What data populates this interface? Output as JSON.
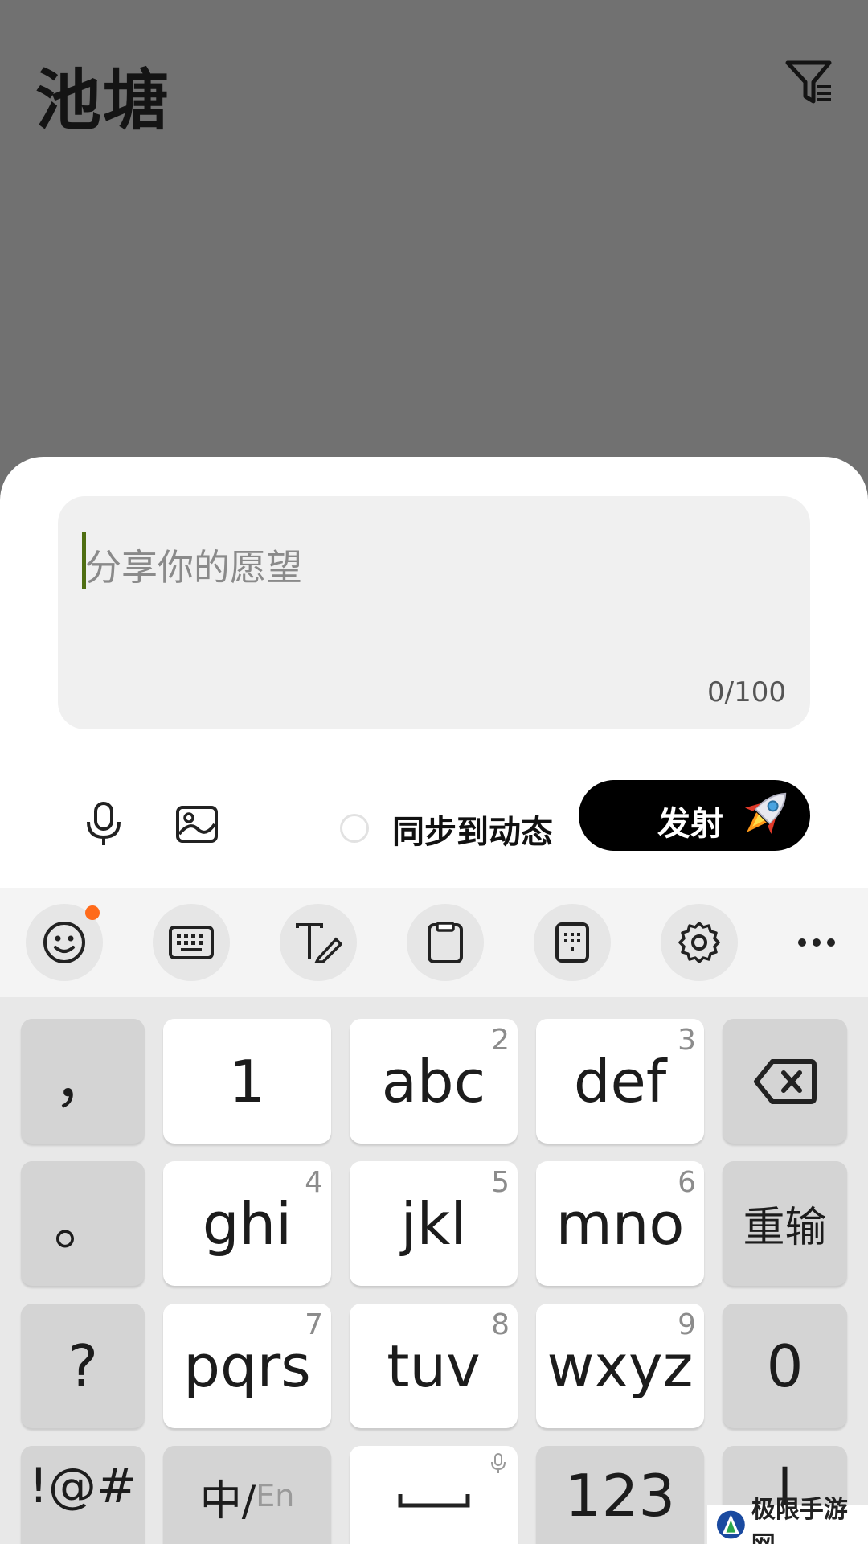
{
  "page": {
    "title": "池塘"
  },
  "icons": {
    "filter": "filter-icon",
    "mic": "microphone-icon",
    "image": "image-icon",
    "rocket": "rocket-icon",
    "emoji": "emoji-icon",
    "keyboard": "keyboard-icon",
    "handwriting": "handwriting-icon",
    "clipboard": "clipboard-icon",
    "numpad": "numpad-icon",
    "settings": "gear-icon",
    "more": "more-icon",
    "backspace": "backspace-icon",
    "space": "space-icon"
  },
  "composer": {
    "placeholder": "分享你的愿望",
    "counter": "0/100",
    "sync_label": "同步到动态",
    "launch_label": "发射"
  },
  "keyboard": {
    "row1": {
      "left": "，",
      "keys": [
        {
          "main": "1",
          "sup": ""
        },
        {
          "main": "abc",
          "sup": "2"
        },
        {
          "main": "def",
          "sup": "3"
        }
      ]
    },
    "row2": {
      "left": "。",
      "keys": [
        {
          "main": "ghi",
          "sup": "4"
        },
        {
          "main": "jkl",
          "sup": "5"
        },
        {
          "main": "mno",
          "sup": "6"
        }
      ],
      "right": "重输"
    },
    "row3": {
      "left": "?",
      "keys": [
        {
          "main": "pqrs",
          "sup": "7"
        },
        {
          "main": "tuv",
          "sup": "8"
        },
        {
          "main": "wxyz",
          "sup": "9"
        }
      ],
      "right": "0"
    },
    "row4": {
      "symbols": "!@#",
      "lang_zh": "中/",
      "lang_en": "En",
      "num": "123",
      "right": "|"
    }
  },
  "watermark": {
    "text": "极限手游网"
  },
  "colors": {
    "accent": "#000000",
    "cursor": "#4f6e12",
    "notification": "#ff6a1a"
  }
}
